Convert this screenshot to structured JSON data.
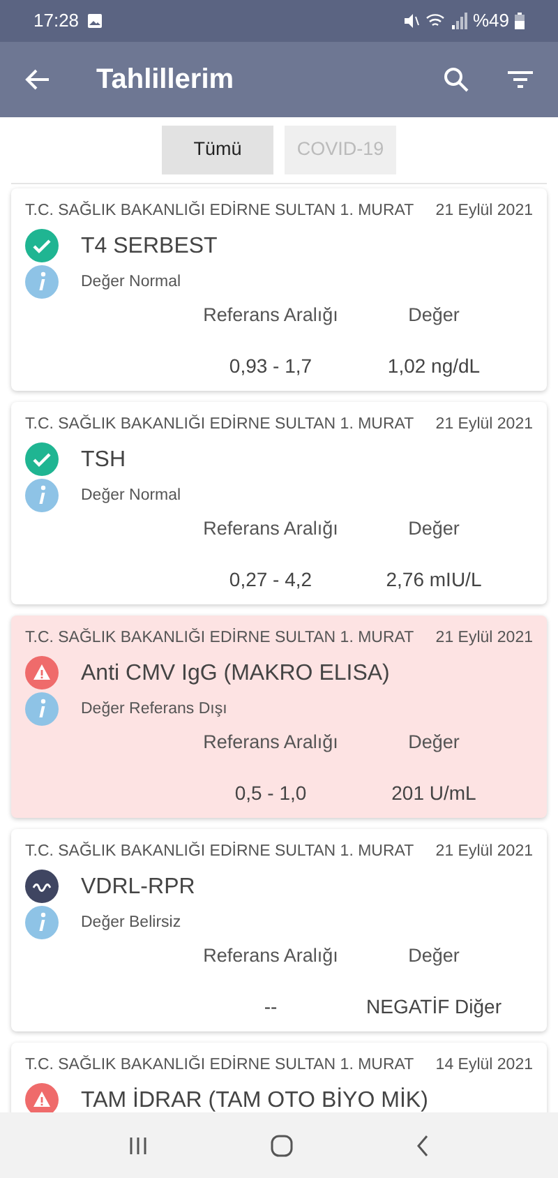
{
  "status_bar": {
    "time": "17:28",
    "battery": "%49"
  },
  "app_bar": {
    "title": "Tahlillerim"
  },
  "tabs": [
    {
      "label": "Tümü",
      "selected": true
    },
    {
      "label": "COVID-19",
      "selected": false
    }
  ],
  "results": [
    {
      "hospital": "T.C. SAĞLIK BAKANLIĞI EDİRNE SULTAN 1. MURAT",
      "date": "21 Eylül 2021",
      "name": "T4 SERBEST",
      "kind": "normal",
      "status": "Değer Normal",
      "range_header": "Referans Aralığı",
      "value_header": "Değer",
      "range": "0,93 - 1,7",
      "value": "1,02 ng/dL"
    },
    {
      "hospital": "T.C. SAĞLIK BAKANLIĞI EDİRNE SULTAN 1. MURAT",
      "date": "21 Eylül 2021",
      "name": "TSH",
      "kind": "normal",
      "status": "Değer Normal",
      "range_header": "Referans Aralığı",
      "value_header": "Değer",
      "range": "0,27 - 4,2",
      "value": "2,76 mIU/L"
    },
    {
      "hospital": "T.C. SAĞLIK BAKANLIĞI EDİRNE SULTAN 1. MURAT",
      "date": "21 Eylül 2021",
      "name": "Anti CMV IgG (MAKRO ELISA)",
      "kind": "abnormal",
      "status": "Değer Referans Dışı",
      "range_header": "Referans Aralığı",
      "value_header": "Değer",
      "range": "0,5 - 1,0",
      "value": "201 U/mL"
    },
    {
      "hospital": "T.C. SAĞLIK BAKANLIĞI EDİRNE SULTAN 1. MURAT",
      "date": "21 Eylül 2021",
      "name": "VDRL-RPR",
      "kind": "uncertain",
      "status": "Değer Belirsiz",
      "range_header": "Referans Aralığı",
      "value_header": "Değer",
      "range": "--",
      "value": "NEGATİF Diğer"
    },
    {
      "hospital": "T.C. SAĞLIK BAKANLIĞI EDİRNE SULTAN 1. MURAT",
      "date": "14 Eylül 2021",
      "name": "TAM İDRAR (TAM OTO BİYO MİK)",
      "kind": "abnormal"
    }
  ]
}
